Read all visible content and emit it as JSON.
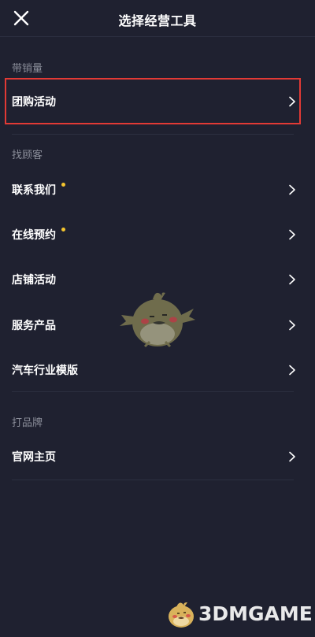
{
  "header": {
    "title": "选择经营工具"
  },
  "sections": [
    {
      "label": "带销量",
      "items": [
        {
          "label": "团购活动",
          "highlighted": true,
          "dot": false
        }
      ]
    },
    {
      "label": "找顾客",
      "items": [
        {
          "label": "联系我们",
          "dot": true
        },
        {
          "label": "在线预约",
          "dot": true
        },
        {
          "label": "店铺活动",
          "dot": false
        },
        {
          "label": "服务产品",
          "dot": false
        },
        {
          "label": "汽车行业模版",
          "dot": false
        }
      ]
    },
    {
      "label": "打品牌",
      "items": [
        {
          "label": "官网主页",
          "dot": false
        }
      ]
    }
  ],
  "watermark": {
    "text": "3DMGAME"
  },
  "colors": {
    "background": "#1f2130",
    "highlight_border": "#e23a35",
    "notification_dot": "#f5c52e",
    "section_label": "#8a8d99"
  },
  "icons": {
    "close": "close-icon",
    "chevron": "chevron-right-icon"
  }
}
